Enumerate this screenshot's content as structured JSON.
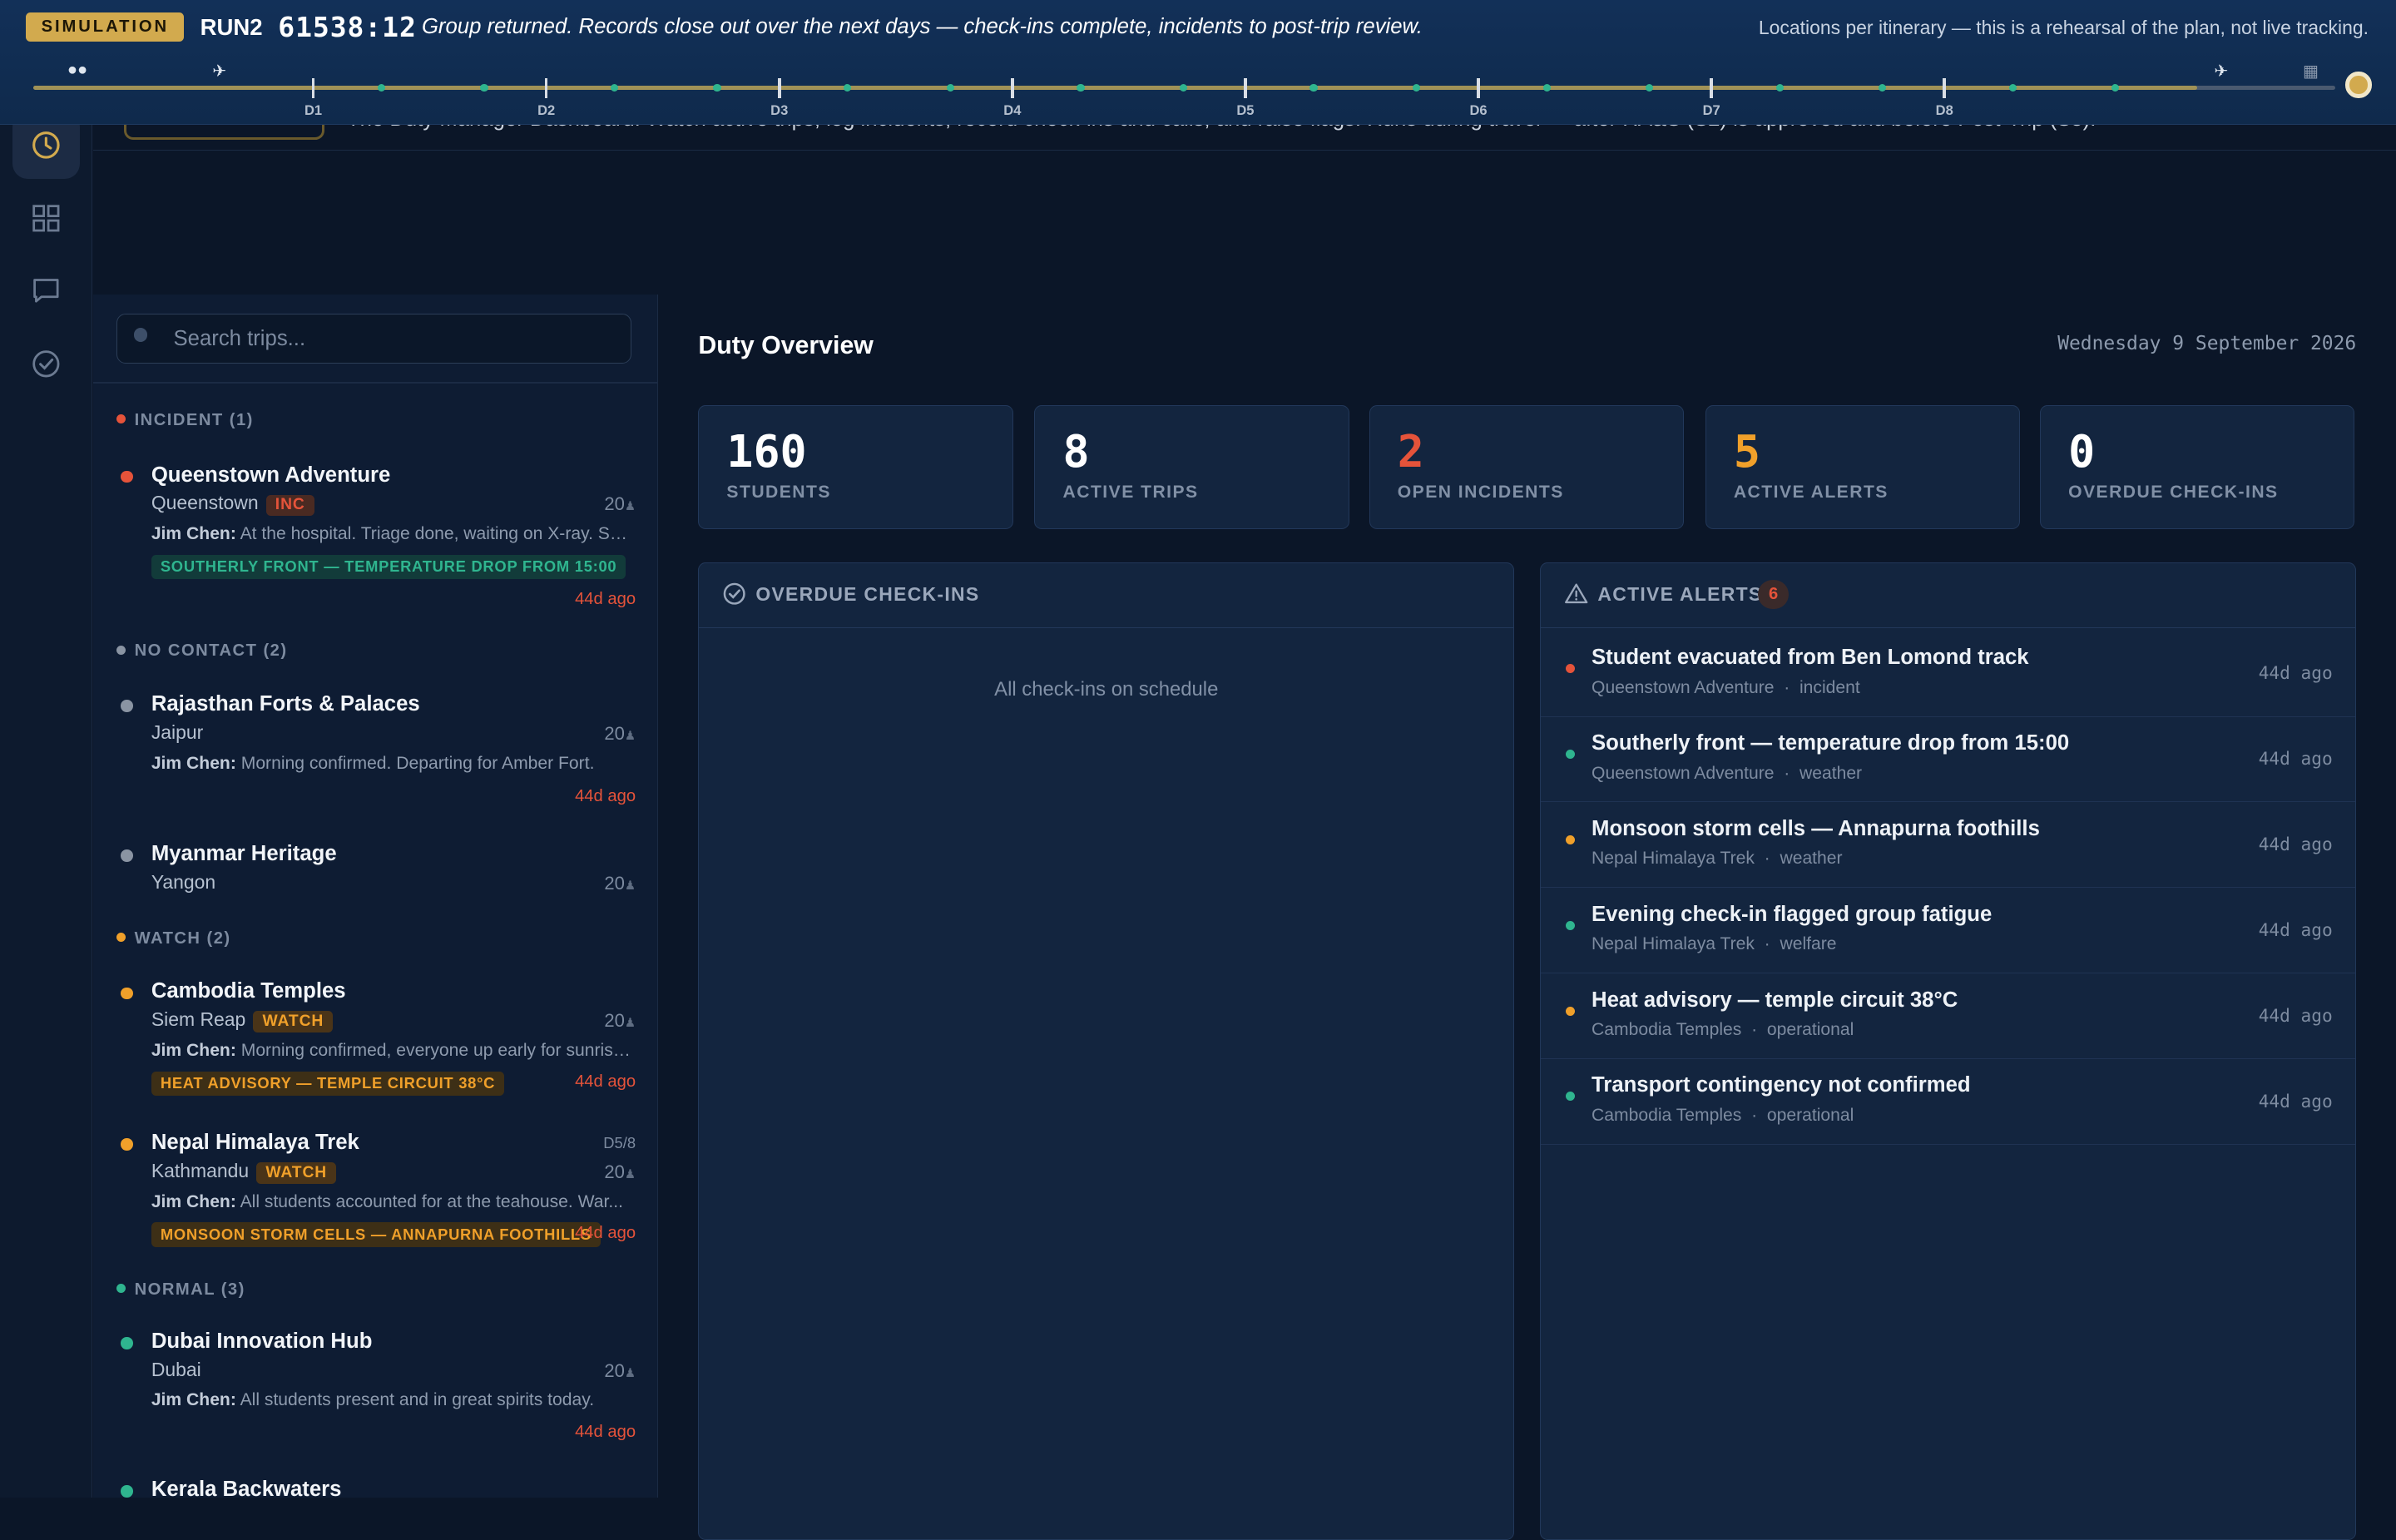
{
  "simulation": {
    "badge": "SIMULATION",
    "run": "RUN2",
    "code": "61538:12",
    "message": "Group returned. Records close out over the next days — check-ins complete, incidents to post-trip review.",
    "note": "Locations per itinerary — this is a rehearsal of the plan, not live tracking.",
    "days": [
      "D1",
      "D2",
      "D3",
      "D4",
      "D5",
      "D6",
      "D7",
      "D8"
    ],
    "progress": 0.94
  },
  "page_header": {
    "description_partial": "The Duty Manager Dashboard. Watch active trips, log incidents, record check-ins and calls, and raise flags. Runs during travel — after RA&S (S2) is approved and before Post-Trip (S5)."
  },
  "search": {
    "placeholder": "Search trips..."
  },
  "groups": [
    {
      "title": "INCIDENT (1)",
      "color": "#e5533a"
    },
    {
      "title": "NO CONTACT (2)",
      "color": "#8a94a3"
    },
    {
      "title": "WATCH (2)",
      "color": "#f0a02a"
    },
    {
      "title": "NORMAL (3)",
      "color": "#2fb58f"
    }
  ],
  "trips": [
    {
      "name": "Queenstown Adventure",
      "city": "Queenstown",
      "badge": "INC",
      "count": "20",
      "sender": "Jim Chen:",
      "message": "At the hospital. Triage done, waiting on X-ray. Sh...",
      "alert": "SOUTHERLY FRONT — TEMPERATURE DROP FROM 15:00",
      "ago": "44d ago",
      "day": ""
    },
    {
      "name": "Rajasthan Forts & Palaces",
      "city": "Jaipur",
      "badge": "",
      "count": "20",
      "sender": "Jim Chen:",
      "message": "Morning confirmed. Departing for Amber Fort.",
      "alert": "",
      "ago": "44d ago",
      "day": ""
    },
    {
      "name": "Myanmar Heritage",
      "city": "Yangon",
      "badge": "",
      "count": "20",
      "sender": "",
      "message": "",
      "alert": "",
      "ago": "",
      "day": ""
    },
    {
      "name": "Cambodia Temples",
      "city": "Siem Reap",
      "badge": "WATCH",
      "count": "20",
      "sender": "Jim Chen:",
      "message": "Morning confirmed, everyone up early for sunrise...",
      "alert": "HEAT ADVISORY — TEMPLE CIRCUIT 38°C",
      "ago": "44d ago",
      "day": ""
    },
    {
      "name": "Nepal Himalaya Trek",
      "city": "Kathmandu",
      "badge": "WATCH",
      "count": "20",
      "sender": "Jim Chen:",
      "message": "All students accounted for at the teahouse. War...",
      "alert": "MONSOON STORM CELLS — ANNAPURNA FOOTHILLS",
      "ago": "44d ago",
      "day": "D5/8"
    },
    {
      "name": "Dubai Innovation Hub",
      "city": "Dubai",
      "badge": "",
      "count": "20",
      "sender": "Jim Chen:",
      "message": "All students present and in great spirits today.",
      "alert": "",
      "ago": "44d ago",
      "day": ""
    },
    {
      "name": "Kerala Backwaters",
      "city": "",
      "badge": "",
      "count": "",
      "sender": "",
      "message": "",
      "alert": "",
      "ago": "",
      "day": ""
    }
  ],
  "overview": {
    "title": "Duty Overview",
    "date": "Wednesday 9 September 2026",
    "stats": [
      {
        "value": "160",
        "label": "STUDENTS",
        "color": "#ffffff"
      },
      {
        "value": "8",
        "label": "ACTIVE TRIPS",
        "color": "#ffffff"
      },
      {
        "value": "2",
        "label": "OPEN INCIDENTS",
        "color": "#e5533a"
      },
      {
        "value": "5",
        "label": "ACTIVE ALERTS",
        "color": "#f0a02a"
      },
      {
        "value": "0",
        "label": "OVERDUE CHECK-INS",
        "color": "#ffffff"
      }
    ]
  },
  "checkins_panel": {
    "title": "OVERDUE CHECK-INS",
    "empty": "All check-ins on schedule"
  },
  "alerts_panel": {
    "title": "ACTIVE ALERTS",
    "count": "6",
    "items": [
      {
        "title": "Student evacuated from Ben Lomond track",
        "trip": "Queenstown Adventure",
        "category": "incident",
        "ago": "44d ago",
        "color": "#e5533a"
      },
      {
        "title": "Southerly front — temperature drop from 15:00",
        "trip": "Queenstown Adventure",
        "category": "weather",
        "ago": "44d ago",
        "color": "#2fb58f"
      },
      {
        "title": "Monsoon storm cells — Annapurna foothills",
        "trip": "Nepal Himalaya Trek",
        "category": "weather",
        "ago": "44d ago",
        "color": "#f0a02a"
      },
      {
        "title": "Evening check-in flagged group fatigue",
        "trip": "Nepal Himalaya Trek",
        "category": "welfare",
        "ago": "44d ago",
        "color": "#2fb58f"
      },
      {
        "title": "Heat advisory — temple circuit 38°C",
        "trip": "Cambodia Temples",
        "category": "operational",
        "ago": "44d ago",
        "color": "#f0a02a"
      },
      {
        "title": "Transport contingency not confirmed",
        "trip": "Cambodia Temples",
        "category": "operational",
        "ago": "44d ago",
        "color": "#2fb58f"
      }
    ]
  },
  "colors": {
    "accent_gold": "#d2aa4e",
    "incident": "#e5533a",
    "watch": "#f0a02a",
    "normal": "#2fb58f",
    "muted": "#8a94a3",
    "incident_badge_bg": "#4a2a22",
    "watch_badge_bg": "#4a3418",
    "green_alert_bg": "#123b3a",
    "amber_alert_bg": "#3d2f16"
  },
  "icons": {
    "rail": [
      "clock-icon",
      "grid-icon",
      "chat-icon",
      "check-circle-icon"
    ],
    "timeline": [
      "people-icon",
      "plane-icon",
      "plane-icon",
      "building-icon"
    ]
  }
}
